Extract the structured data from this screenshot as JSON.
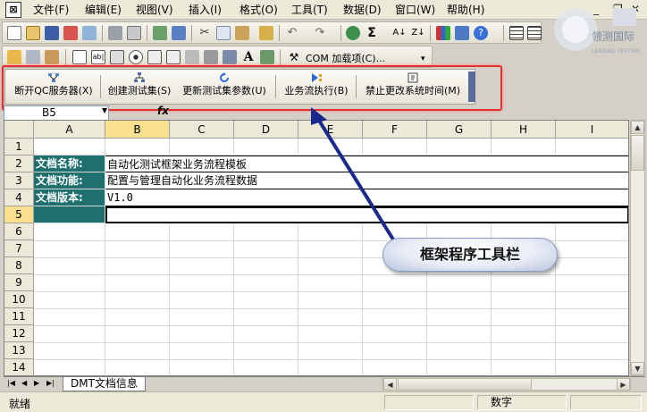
{
  "menubar": {
    "items": [
      {
        "label": "文件(F)"
      },
      {
        "label": "编辑(E)"
      },
      {
        "label": "视图(V)"
      },
      {
        "label": "插入(I)"
      },
      {
        "label": "格式(O)"
      },
      {
        "label": "工具(T)"
      },
      {
        "label": "数据(D)"
      },
      {
        "label": "窗口(W)"
      },
      {
        "label": "帮助(H)"
      }
    ]
  },
  "toolbar2": {
    "com_addins": "COM 加载项(C)..."
  },
  "framework_toolbar": {
    "buttons": [
      {
        "label": "断开QC服务器(X)",
        "icon": "network-icon"
      },
      {
        "label": "创建测试集(S)",
        "icon": "tree-icon"
      },
      {
        "label": "更新测试集参数(U)",
        "icon": "refresh-icon"
      },
      {
        "label": "业务流执行(B)",
        "icon": "run-icon"
      },
      {
        "label": "禁止更改系统时间(M)",
        "icon": "clock-icon"
      }
    ]
  },
  "formula_bar": {
    "name_box": "B5",
    "fx": "fx"
  },
  "grid": {
    "columns": [
      "A",
      "B",
      "C",
      "D",
      "E",
      "F",
      "G",
      "H",
      "I"
    ],
    "rows": [
      "1",
      "2",
      "3",
      "4",
      "5",
      "6",
      "7",
      "8",
      "9",
      "10",
      "11",
      "12",
      "13",
      "14"
    ],
    "cells": {
      "a2": "文档名称:",
      "b2": "自动化测试框架业务流程模板",
      "a3": "文档功能:",
      "b3": "配置与管理自动化业务流程数据",
      "a4": "文档版本:",
      "b4": "V1.0"
    }
  },
  "sheet_tabs": {
    "active": "DMT文档信息"
  },
  "statusbar": {
    "ready": "就绪",
    "mode": "数字"
  },
  "annotation": {
    "callout": "框架程序工具栏"
  },
  "watermark": {
    "text": "领测国际",
    "subtext": "LEADING TESTING"
  },
  "colors": {
    "label_cell_bg": "#1f6f6f",
    "highlight_border": "#e03030",
    "arrow": "#1a2a8c"
  }
}
